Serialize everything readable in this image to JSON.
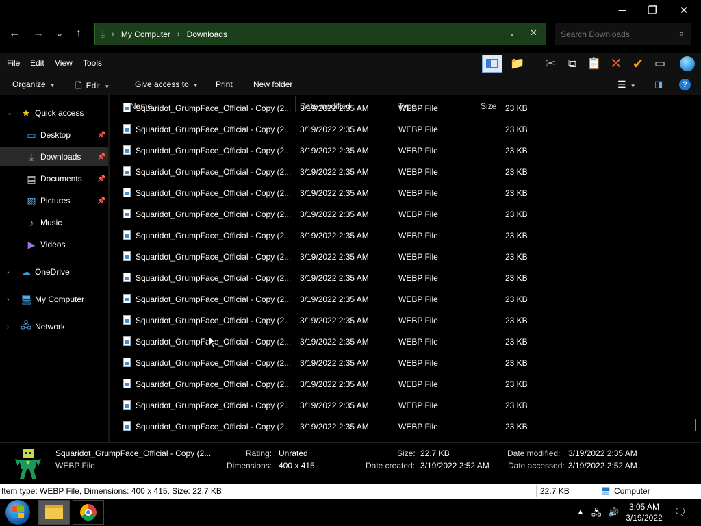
{
  "window": {
    "minimize": "─",
    "maximize": "❐",
    "close": "✕"
  },
  "nav": {
    "back": "←",
    "forward": "→",
    "recent": "⌄",
    "up": "↑"
  },
  "address": {
    "crumbs": [
      "My Computer",
      "Downloads"
    ]
  },
  "search": {
    "placeholder": "Search Downloads"
  },
  "menu": [
    "File",
    "Edit",
    "View",
    "Tools"
  ],
  "commands": {
    "organize": "Organize",
    "edit": "Edit",
    "give_access": "Give access to",
    "print": "Print",
    "new_folder": "New folder"
  },
  "sidebar": {
    "quick_access": "Quick access",
    "items": [
      {
        "label": "Desktop",
        "icon": "desktop-icon"
      },
      {
        "label": "Downloads",
        "icon": "download-icon"
      },
      {
        "label": "Documents",
        "icon": "documents-icon"
      },
      {
        "label": "Pictures",
        "icon": "pictures-icon"
      },
      {
        "label": "Music",
        "icon": "music-icon"
      },
      {
        "label": "Videos",
        "icon": "videos-icon"
      }
    ],
    "onedrive": "OneDrive",
    "my_computer": "My Computer",
    "network": "Network"
  },
  "columns": {
    "name": "Name",
    "date": "Date modified",
    "type": "Type",
    "size": "Size"
  },
  "files": {
    "rows": [
      {
        "name": "Squaridot_GrumpFace_Official - Copy (2...",
        "date": "3/19/2022 2:35 AM",
        "type": "WEBP File",
        "size": "23 KB"
      },
      {
        "name": "Squaridot_GrumpFace_Official - Copy (2...",
        "date": "3/19/2022 2:35 AM",
        "type": "WEBP File",
        "size": "23 KB"
      },
      {
        "name": "Squaridot_GrumpFace_Official - Copy (2...",
        "date": "3/19/2022 2:35 AM",
        "type": "WEBP File",
        "size": "23 KB"
      },
      {
        "name": "Squaridot_GrumpFace_Official - Copy (2...",
        "date": "3/19/2022 2:35 AM",
        "type": "WEBP File",
        "size": "23 KB"
      },
      {
        "name": "Squaridot_GrumpFace_Official - Copy (2...",
        "date": "3/19/2022 2:35 AM",
        "type": "WEBP File",
        "size": "23 KB"
      },
      {
        "name": "Squaridot_GrumpFace_Official - Copy (2...",
        "date": "3/19/2022 2:35 AM",
        "type": "WEBP File",
        "size": "23 KB"
      },
      {
        "name": "Squaridot_GrumpFace_Official - Copy (2...",
        "date": "3/19/2022 2:35 AM",
        "type": "WEBP File",
        "size": "23 KB"
      },
      {
        "name": "Squaridot_GrumpFace_Official - Copy (2...",
        "date": "3/19/2022 2:35 AM",
        "type": "WEBP File",
        "size": "23 KB"
      },
      {
        "name": "Squaridot_GrumpFace_Official - Copy (2...",
        "date": "3/19/2022 2:35 AM",
        "type": "WEBP File",
        "size": "23 KB"
      },
      {
        "name": "Squaridot_GrumpFace_Official - Copy (2...",
        "date": "3/19/2022 2:35 AM",
        "type": "WEBP File",
        "size": "23 KB"
      },
      {
        "name": "Squaridot_GrumpFace_Official - Copy (2...",
        "date": "3/19/2022 2:35 AM",
        "type": "WEBP File",
        "size": "23 KB"
      },
      {
        "name": "Squaridot_GrumpFace_Official - Copy (2...",
        "date": "3/19/2022 2:35 AM",
        "type": "WEBP File",
        "size": "23 KB"
      },
      {
        "name": "Squaridot_GrumpFace_Official - Copy (2...",
        "date": "3/19/2022 2:35 AM",
        "type": "WEBP File",
        "size": "23 KB"
      },
      {
        "name": "Squaridot_GrumpFace_Official - Copy (2...",
        "date": "3/19/2022 2:35 AM",
        "type": "WEBP File",
        "size": "23 KB"
      },
      {
        "name": "Squaridot_GrumpFace_Official - Copy (2...",
        "date": "3/19/2022 2:35 AM",
        "type": "WEBP File",
        "size": "23 KB"
      },
      {
        "name": "Squaridot_GrumpFace_Official - Copy (2...",
        "date": "3/19/2022 2:35 AM",
        "type": "WEBP File",
        "size": "23 KB"
      }
    ]
  },
  "details": {
    "name": "Squaridot_GrumpFace_Official - Copy (2...",
    "type": "WEBP File",
    "rating_label": "Rating:",
    "rating": "Unrated",
    "dimensions_label": "Dimensions:",
    "dimensions": "400 x 415",
    "size_label": "Size:",
    "size": "22.7 KB",
    "created_label": "Date created:",
    "created": "3/19/2022 2:52 AM",
    "modified_label": "Date modified:",
    "modified": "3/19/2022 2:35 AM",
    "accessed_label": "Date accessed:",
    "accessed": "3/19/2022 2:52 AM"
  },
  "status": {
    "info": "Item type: WEBP File, Dimensions: 400 x 415, Size: 22.7 KB",
    "size": "22.7 KB",
    "location": "Computer"
  },
  "taskbar": {
    "time": "3:05 AM",
    "date": "3/19/2022"
  },
  "colors": {
    "address_bg": "#1a3f1a",
    "accent_green": "#4dd24d",
    "selection": "#2a2a2a"
  }
}
